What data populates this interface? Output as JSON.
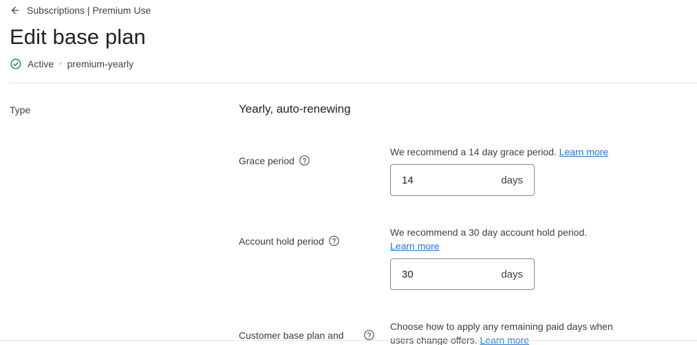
{
  "breadcrumb": {
    "label": "Subscriptions | Premium Use"
  },
  "page_title": "Edit base plan",
  "status": {
    "state": "Active",
    "separator": "•",
    "plan_id": "premium-yearly",
    "color": "#1e8e3e"
  },
  "type_section": {
    "label": "Type",
    "value": "Yearly, auto-renewing"
  },
  "grace_period": {
    "label": "Grace period",
    "hint": "We recommend a 14 day grace period.",
    "link": "Learn more",
    "value": "14",
    "suffix": "days"
  },
  "account_hold": {
    "label": "Account hold period",
    "hint": "We recommend a 30 day account hold period.",
    "link": "Learn more",
    "value": "30",
    "suffix": "days"
  },
  "customer_change": {
    "label": "Customer base plan and",
    "hint": "Choose how to apply any remaining paid days when users change offers.",
    "link": "Learn more"
  },
  "colors": {
    "link": "#1a73e8",
    "active_green": "#1e8e3e",
    "border": "#80868b"
  }
}
